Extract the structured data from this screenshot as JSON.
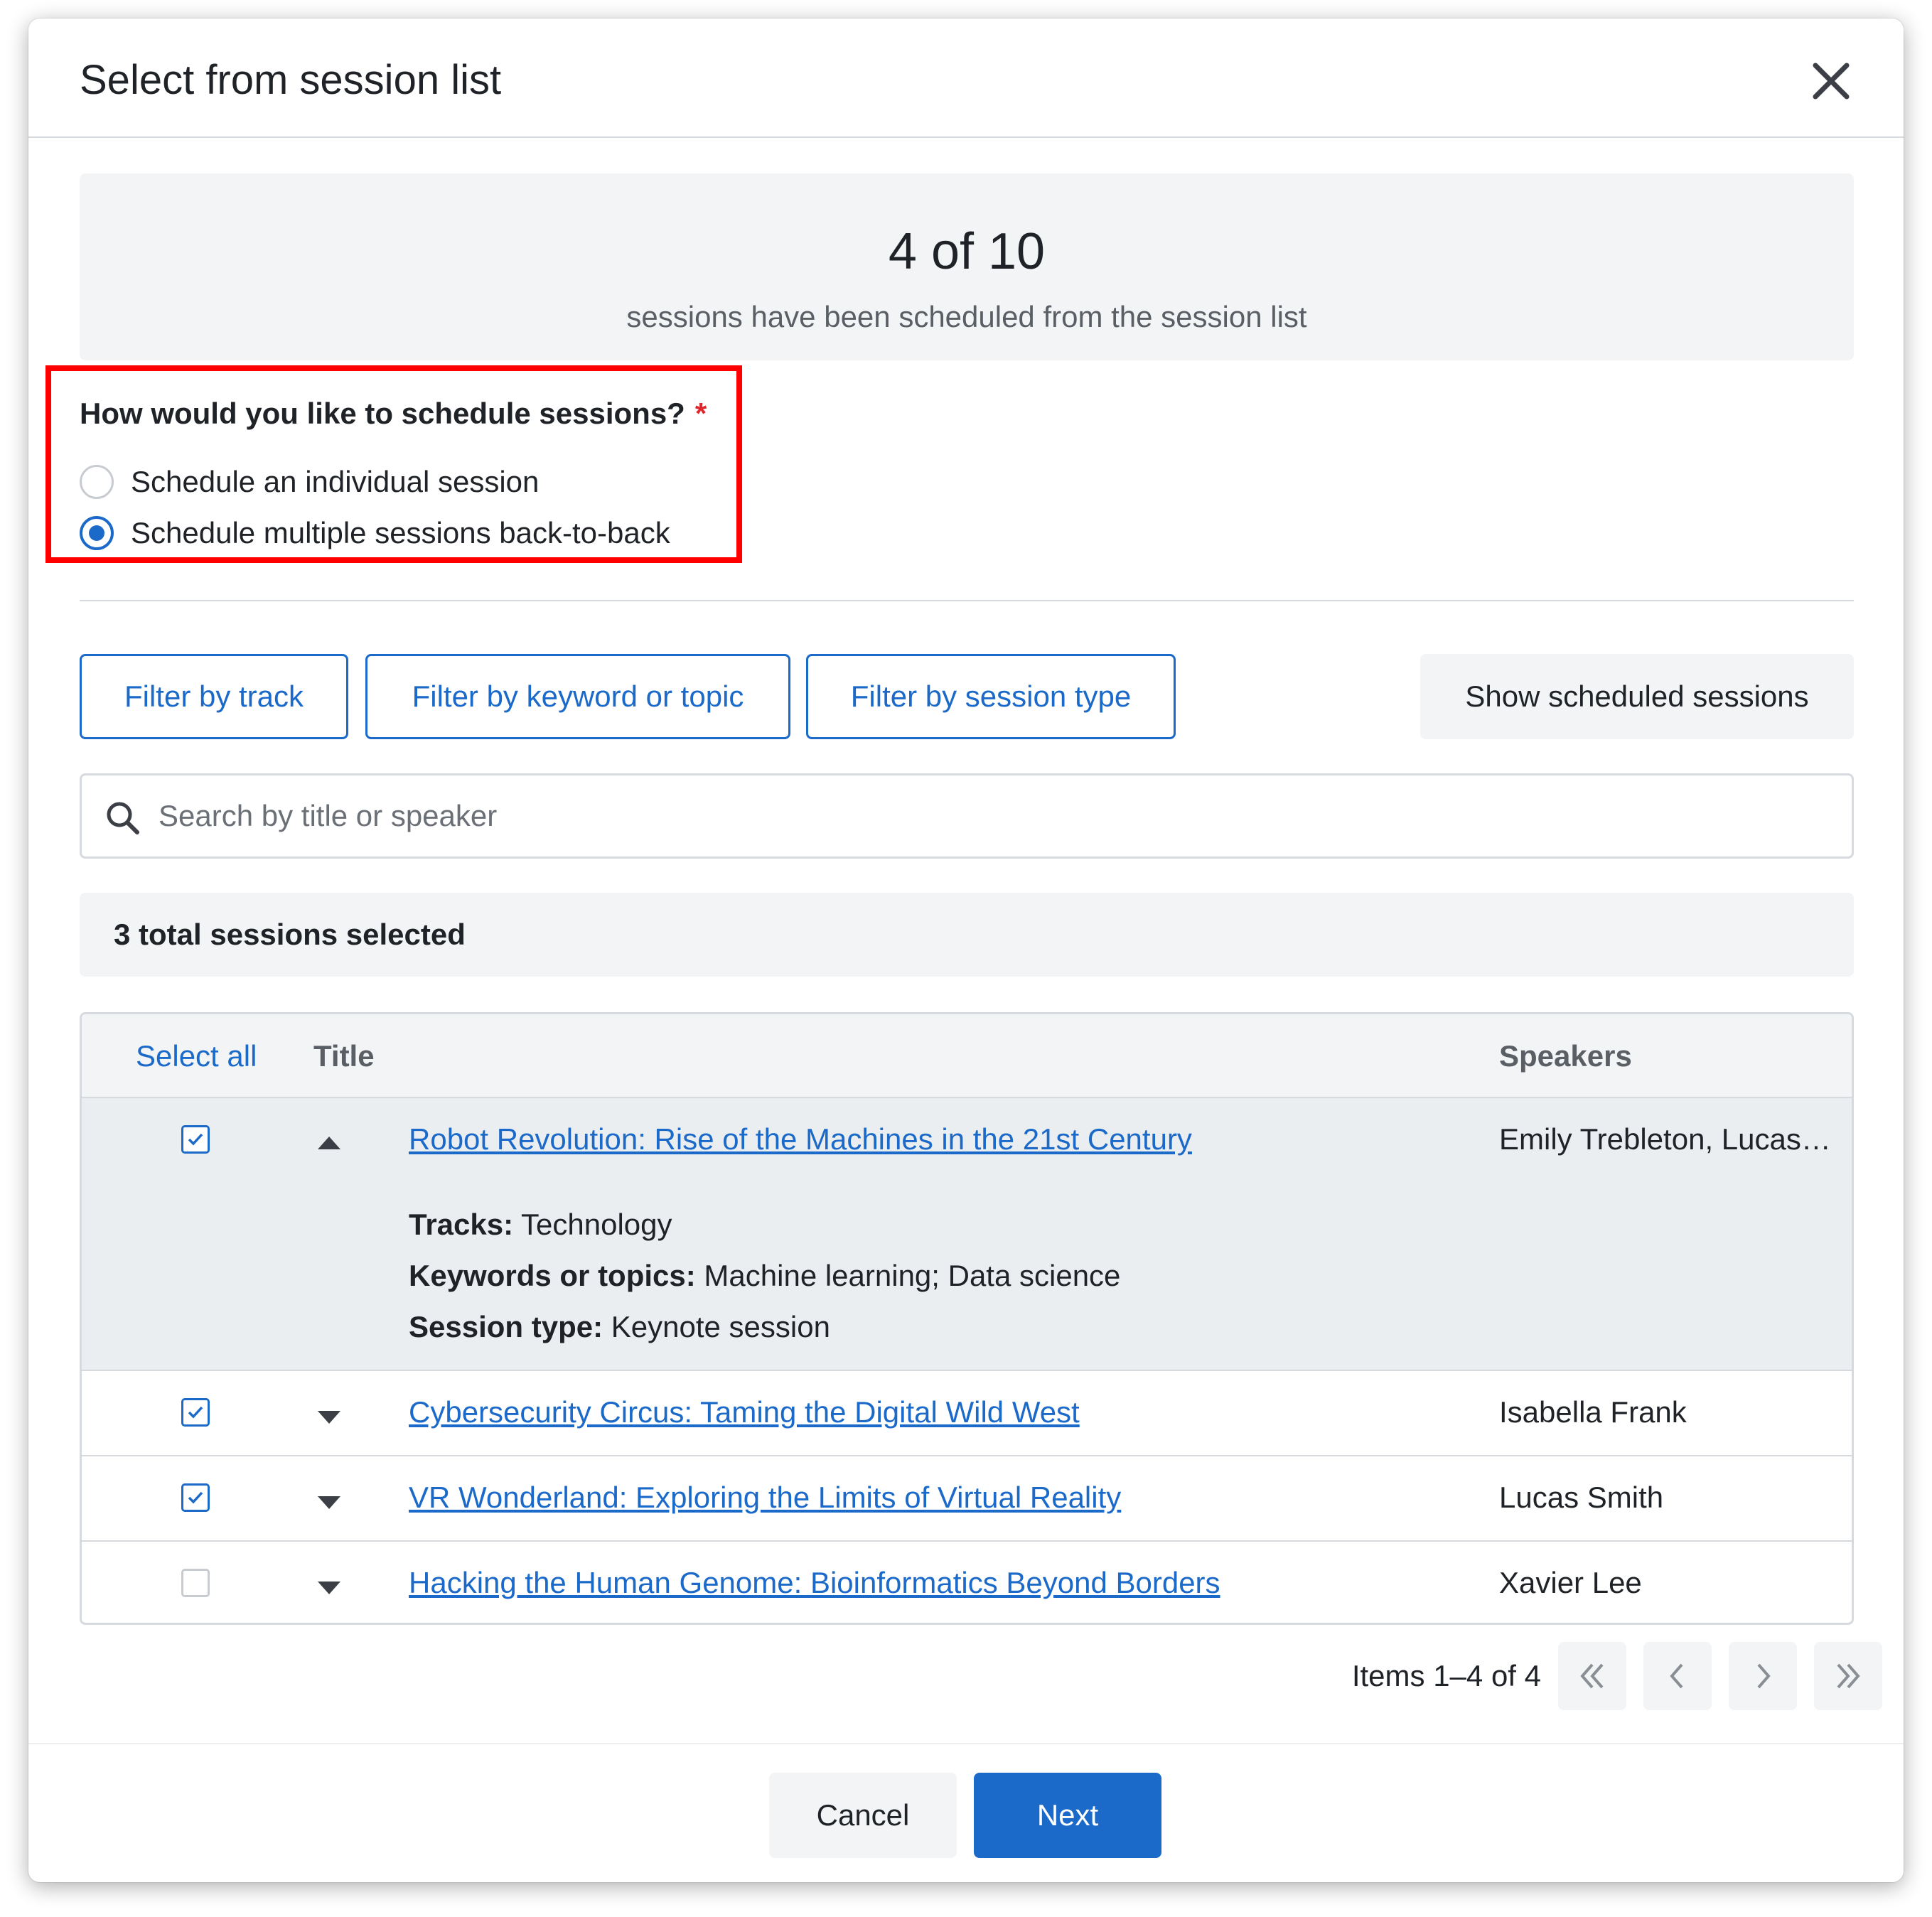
{
  "modal": {
    "title": "Select from session list",
    "close_icon": "close-icon"
  },
  "summary": {
    "count": "4 of 10",
    "text": "sessions have been scheduled from the session list"
  },
  "schedule_question": {
    "label": "How would you like to schedule sessions?",
    "required_mark": "*",
    "options": [
      {
        "label": "Schedule an individual session",
        "selected": false
      },
      {
        "label": "Schedule multiple sessions back-to-back",
        "selected": true
      }
    ]
  },
  "filters": {
    "track": "Filter by track",
    "keyword": "Filter by keyword or topic",
    "session_type": "Filter by session type",
    "show_scheduled": "Show scheduled sessions"
  },
  "search": {
    "placeholder": "Search by title or speaker",
    "value": "",
    "icon": "search-icon"
  },
  "selected_summary": "3 total sessions selected",
  "table": {
    "headers": {
      "select_all": "Select all",
      "title": "Title",
      "speakers": "Speakers"
    },
    "rows": [
      {
        "checked": true,
        "expanded": true,
        "title": "Robot Revolution: Rise of the Machines in the 21st Century",
        "speakers": "Emily Trebleton, Lucas…",
        "details": {
          "tracks_label": "Tracks:",
          "tracks": "Technology",
          "keywords_label": "Keywords or topics:",
          "keywords": "Machine learning; Data science",
          "type_label": "Session type:",
          "type": "Keynote session"
        }
      },
      {
        "checked": true,
        "expanded": false,
        "title": "Cybersecurity Circus: Taming the Digital Wild West",
        "speakers": "Isabella Frank"
      },
      {
        "checked": true,
        "expanded": false,
        "title": "VR Wonderland: Exploring the Limits of Virtual Reality",
        "speakers": "Lucas Smith"
      },
      {
        "checked": false,
        "expanded": false,
        "title": "Hacking the Human Genome: Bioinformatics Beyond Borders",
        "speakers": "Xavier Lee"
      }
    ]
  },
  "pagination": {
    "text": "Items 1–4 of 4",
    "icons": [
      "double-chevron-left-icon",
      "chevron-left-icon",
      "chevron-right-icon",
      "double-chevron-right-icon"
    ]
  },
  "footer": {
    "cancel": "Cancel",
    "next": "Next"
  },
  "colors": {
    "accent": "#1b6ac9",
    "highlight": "#ff0000",
    "required": "#e0262b"
  }
}
